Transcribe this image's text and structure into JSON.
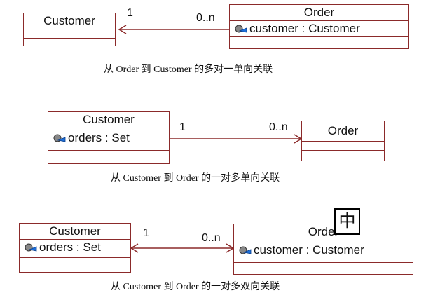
{
  "diagrams": [
    {
      "left_class": {
        "name": "Customer",
        "attributes": []
      },
      "right_class": {
        "name": "Order",
        "attributes": [
          "customer : Customer"
        ]
      },
      "left_multiplicity": "1",
      "right_multiplicity": "0..n",
      "caption": "从 Order 到 Customer 的多对一单向关联"
    },
    {
      "left_class": {
        "name": "Customer",
        "attributes": [
          "orders : Set"
        ]
      },
      "right_class": {
        "name": "Order",
        "attributes": []
      },
      "left_multiplicity": "1",
      "right_multiplicity": "0..n",
      "caption": "从 Customer 到 Order 的一对多单向关联"
    },
    {
      "left_class": {
        "name": "Customer",
        "attributes": [
          "orders : Set"
        ]
      },
      "right_class": {
        "name": "Order",
        "attributes": [
          "customer : Customer"
        ]
      },
      "left_multiplicity": "1",
      "right_multiplicity": "0..n",
      "caption": "从 Customer 到 Order 的一对多双向关联"
    }
  ],
  "overlay_char": "中",
  "colors": {
    "class_border": "#8b2a2a",
    "line": "#8b2a2a",
    "icon": "#1e6fd9"
  }
}
